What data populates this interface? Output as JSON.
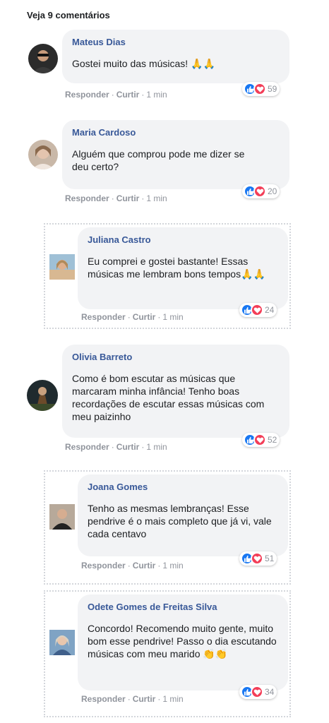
{
  "header": {
    "title": "Veja 9 comentários"
  },
  "labels": {
    "reply": "Responder",
    "like": "Curtir",
    "sep": "·"
  },
  "icons": {
    "like": "thumbs-up-icon",
    "love": "heart-icon",
    "emoji_pray": "🙏",
    "emoji_clap": "👏"
  },
  "colors": {
    "name": "#385898",
    "bubble": "#f2f3f5",
    "like": "#1877f2",
    "love": "#f33e58",
    "meta": "#90949c"
  },
  "comments": [
    {
      "name": "Mateus Dias",
      "text": "Gostei muito das músicas! 🙏🙏",
      "time": "1 min",
      "count": "59"
    },
    {
      "name": "Maria Cardoso",
      "text": "Alguém que comprou pode me dizer se deu certo?",
      "time": "1 min",
      "count": "20"
    },
    {
      "name": "Juliana Castro",
      "text": "Eu comprei e gostei bastante! Essas músicas me lembram bons tempos🙏🙏",
      "time": "1 min",
      "count": "24"
    },
    {
      "name": "Olivia Barreto",
      "text": "Como é bom escutar as músicas que marcaram minha infância! Tenho boas recordações de escutar essas músicas com meu paizinho",
      "time": "1 min",
      "count": "52"
    },
    {
      "name": "Joana Gomes",
      "text": "Tenho as mesmas lembranças! Esse pendrive é o mais completo que já vi, vale cada centavo",
      "time": "1 min",
      "count": "51"
    },
    {
      "name": "Odete Gomes de Freitas Silva",
      "text": "Concordo! Recomendo muito gente, muito bom esse pendrive! Passo o dia escutando músicas com meu marido 👏👏",
      "time": "1 min",
      "count": "34"
    }
  ]
}
